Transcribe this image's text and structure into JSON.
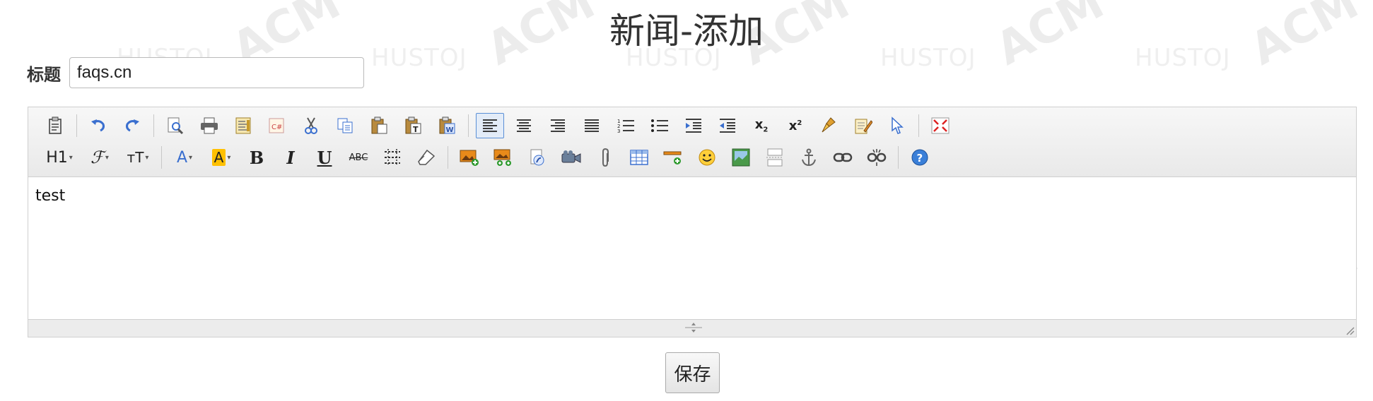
{
  "page": {
    "heading": "新闻-添加",
    "title_label": "标题",
    "title_value": "faqs.cn",
    "save_label": "保存"
  },
  "watermark": {
    "brand": "ACM",
    "sub": "HUSTOJ"
  },
  "editor": {
    "content_text": "test",
    "toolbar_row1": [
      "source-code",
      "undo",
      "redo",
      "preview",
      "print",
      "template",
      "insert-code",
      "cut",
      "copy",
      "paste",
      "paste-plaintext",
      "paste-word",
      "align-left",
      "align-center",
      "align-right",
      "align-justify",
      "ordered-list",
      "unordered-list",
      "indent",
      "outdent",
      "subscript",
      "superscript",
      "clear-format",
      "quick-format",
      "select-all",
      "fullscreen"
    ],
    "toolbar_row2": [
      "heading",
      "font-family",
      "font-size",
      "font-color",
      "highlight-color",
      "bold",
      "italic",
      "underline",
      "strikethrough",
      "line-height",
      "remove-format",
      "image",
      "multi-image",
      "flash",
      "media",
      "attachment",
      "table",
      "horizontal-rule",
      "emoticon",
      "map",
      "page-break",
      "anchor",
      "link",
      "unlink",
      "help"
    ],
    "labels": {
      "heading": "H1",
      "font_family": "ℱ",
      "font_size": "тT",
      "font_color": "A",
      "highlight": "A",
      "bold": "B",
      "italic": "I",
      "underline": "U",
      "strike": "ABC",
      "subscript": "x",
      "superscript": "x"
    }
  },
  "colors": {
    "accent": "#3a6fcf",
    "highlight": "#ffc000",
    "toolbar_bg": "#f0f0f0"
  }
}
